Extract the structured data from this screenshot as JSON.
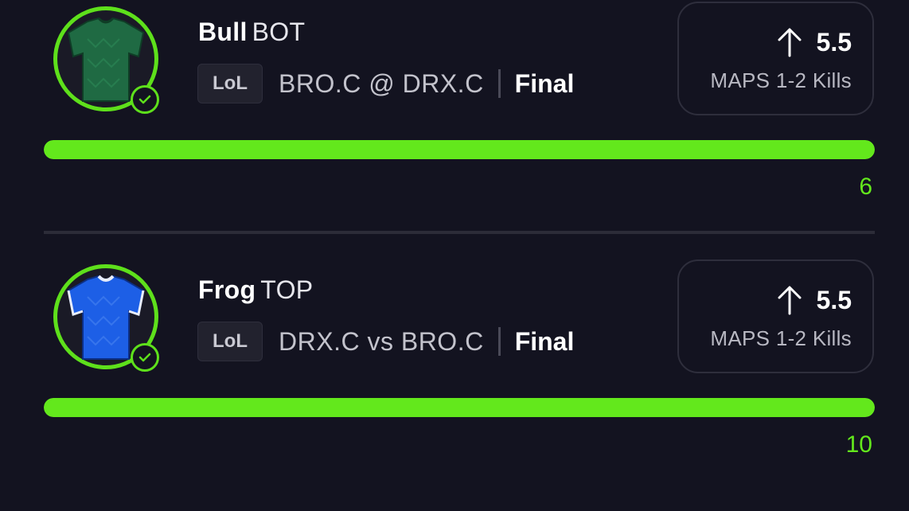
{
  "picks": [
    {
      "player_name": "Bull",
      "position": "BOT",
      "league": "LoL",
      "matchup": "BRO.C @ DRX.C",
      "status": "Final",
      "direction": "up-arrow-icon",
      "line": "5.5",
      "stat": "MAPS 1-2 Kills",
      "result": "6",
      "progress": 1.0,
      "jersey_color": "#1f6a43"
    },
    {
      "player_name": "Frog",
      "position": "TOP",
      "league": "LoL",
      "matchup": "DRX.C vs BRO.C",
      "status": "Final",
      "direction": "up-arrow-icon",
      "line": "5.5",
      "stat": "MAPS 1-2 Kills",
      "result": "10",
      "progress": 1.0,
      "jersey_color": "#1d5fe6"
    }
  ],
  "colors": {
    "accent": "#63e81c",
    "background": "#131320",
    "border": "#2e2e3c"
  }
}
